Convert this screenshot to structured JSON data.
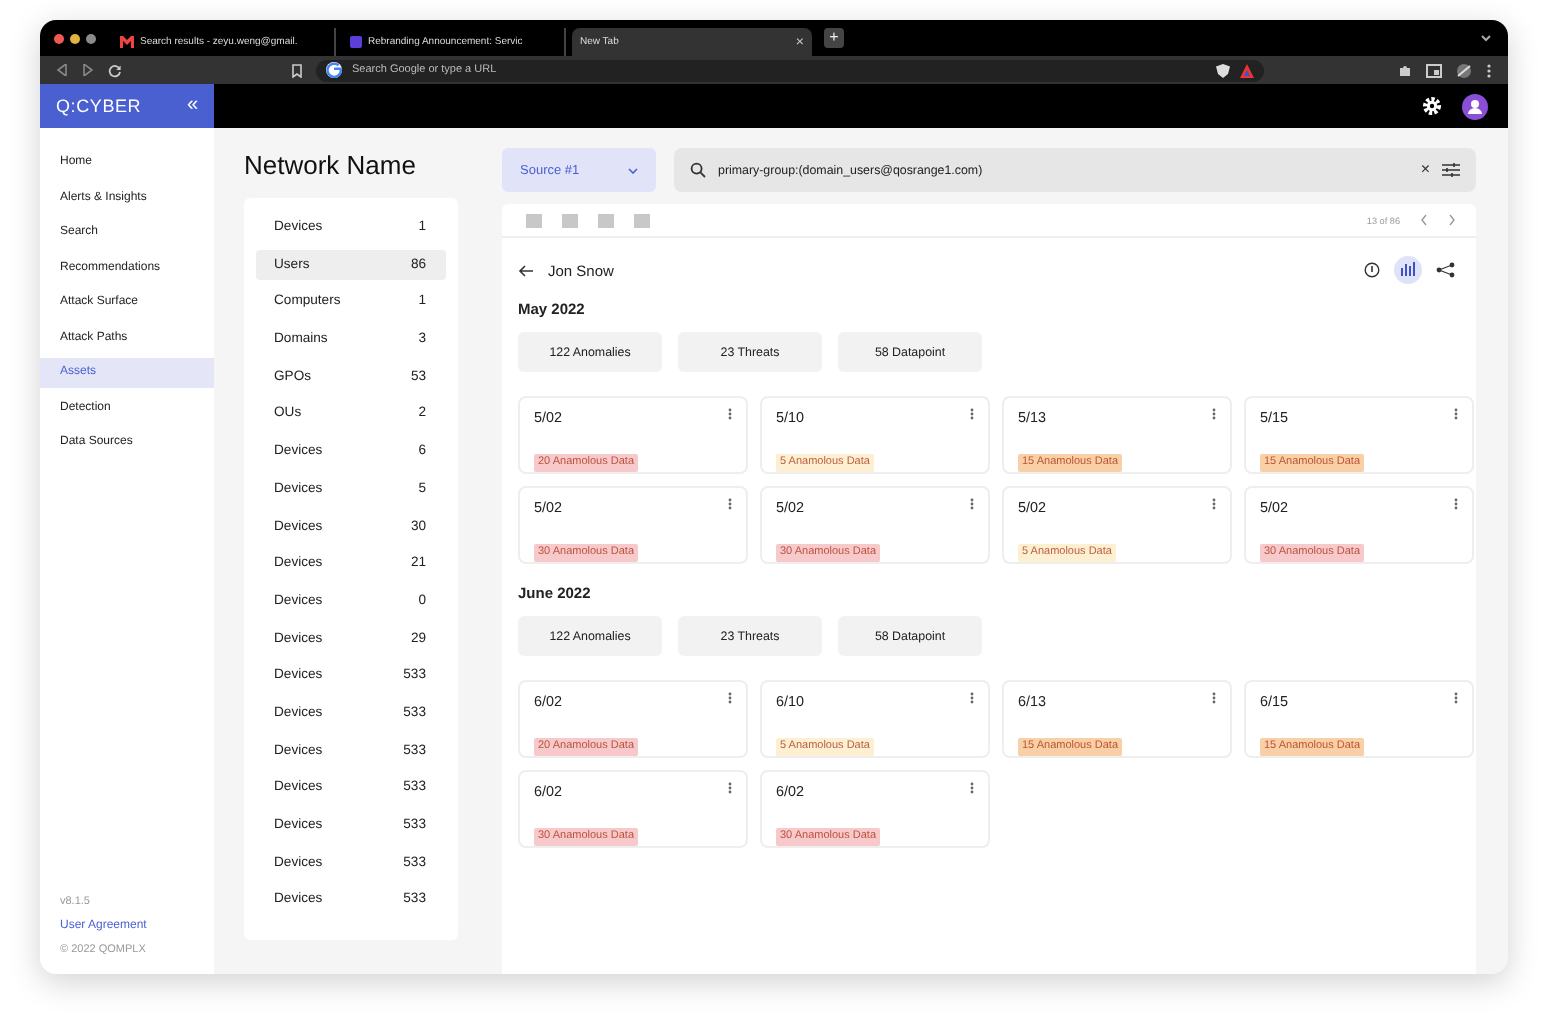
{
  "browser": {
    "tabs": [
      {
        "label": "Search results - zeyu.weng@gmail.",
        "selected": false
      },
      {
        "label": "Rebranding Announcement: Servic",
        "selected": false
      },
      {
        "label": "New Tab",
        "selected": true
      }
    ],
    "close_tab": "×",
    "new_tab": "+",
    "address": {
      "placeholder": "Search Google or type a URL"
    }
  },
  "app": {
    "logo": "Q:CYBER",
    "collapse": "«"
  },
  "sidebar": {
    "items": [
      {
        "label": "Home",
        "selected": false
      },
      {
        "label": "Alerts & Insights",
        "selected": false
      },
      {
        "label": "Search",
        "selected": false
      },
      {
        "label": "Recommendations",
        "selected": false
      },
      {
        "label": "Attack Surface",
        "selected": false
      },
      {
        "label": "Attack Paths",
        "selected": false
      },
      {
        "label": "Assets",
        "selected": true
      },
      {
        "label": "Detection",
        "selected": false
      },
      {
        "label": "Data Sources",
        "selected": false
      }
    ],
    "version": "v8.1.5",
    "link": "User Agreement",
    "copyright": "© 2022 QOMPLX"
  },
  "network": {
    "title": "Network Name",
    "items": [
      {
        "label": "Devices",
        "count": "1",
        "selected": false
      },
      {
        "label": "Users",
        "count": "86",
        "selected": true
      },
      {
        "label": "Computers",
        "count": "1",
        "selected": false
      },
      {
        "label": "Domains",
        "count": "3",
        "selected": false
      },
      {
        "label": "GPOs",
        "count": "53",
        "selected": false
      },
      {
        "label": "OUs",
        "count": "2",
        "selected": false
      },
      {
        "label": "Devices",
        "count": "6",
        "selected": false
      },
      {
        "label": "Devices",
        "count": "5",
        "selected": false
      },
      {
        "label": "Devices",
        "count": "30",
        "selected": false
      },
      {
        "label": "Devices",
        "count": "21",
        "selected": false
      },
      {
        "label": "Devices",
        "count": "0",
        "selected": false
      },
      {
        "label": "Devices",
        "count": "29",
        "selected": false
      },
      {
        "label": "Devices",
        "count": "533",
        "selected": false
      },
      {
        "label": "Devices",
        "count": "533",
        "selected": false
      },
      {
        "label": "Devices",
        "count": "533",
        "selected": false
      },
      {
        "label": "Devices",
        "count": "533",
        "selected": false
      },
      {
        "label": "Devices",
        "count": "533",
        "selected": false
      },
      {
        "label": "Devices",
        "count": "533",
        "selected": false
      },
      {
        "label": "Devices",
        "count": "533",
        "selected": false
      }
    ]
  },
  "source": {
    "value": "Source #1"
  },
  "search": {
    "value": "primary-group:(domain_users@qosrange1.com)",
    "clear": "×"
  },
  "detail": {
    "pager": "13 of 86",
    "name": "Jon Snow",
    "months": [
      {
        "title": "May 2022",
        "stats": [
          "122 Anomalies",
          "23 Threats",
          "58 Datapoint"
        ],
        "cards": [
          {
            "date": "5/02",
            "tag": "20 Anamolous Data",
            "color": "#f7c9cb"
          },
          {
            "date": "5/10",
            "tag": "5 Anamolous Data",
            "color": "#fcefd2"
          },
          {
            "date": "5/13",
            "tag": "15 Anamolous Data",
            "color": "#f9cfa8"
          },
          {
            "date": "5/15",
            "tag": "15 Anamolous Data",
            "color": "#f9cfa8"
          },
          {
            "date": "5/02",
            "tag": "30 Anamolous Data",
            "color": "#f7c9cb"
          },
          {
            "date": "5/02",
            "tag": "30 Anamolous Data",
            "color": "#f7c9cb"
          },
          {
            "date": "5/02",
            "tag": "5 Anamolous Data",
            "color": "#fcefd2"
          },
          {
            "date": "5/02",
            "tag": "30 Anamolous Data",
            "color": "#f7c9cb"
          }
        ]
      },
      {
        "title": "June 2022",
        "stats": [
          "122 Anomalies",
          "23 Threats",
          "58 Datapoint"
        ],
        "cards": [
          {
            "date": "6/02",
            "tag": "20 Anamolous Data",
            "color": "#f7c9cb"
          },
          {
            "date": "6/10",
            "tag": "5 Anamolous Data",
            "color": "#fcefd2"
          },
          {
            "date": "6/13",
            "tag": "15 Anamolous Data",
            "color": "#f9cfa8"
          },
          {
            "date": "6/15",
            "tag": "15 Anamolous Data",
            "color": "#f9cfa8"
          },
          {
            "date": "6/02",
            "tag": "30 Anamolous Data",
            "color": "#f7c9cb"
          },
          {
            "date": "6/02",
            "tag": "30 Anamolous Data",
            "color": "#f7c9cb"
          }
        ]
      }
    ]
  }
}
